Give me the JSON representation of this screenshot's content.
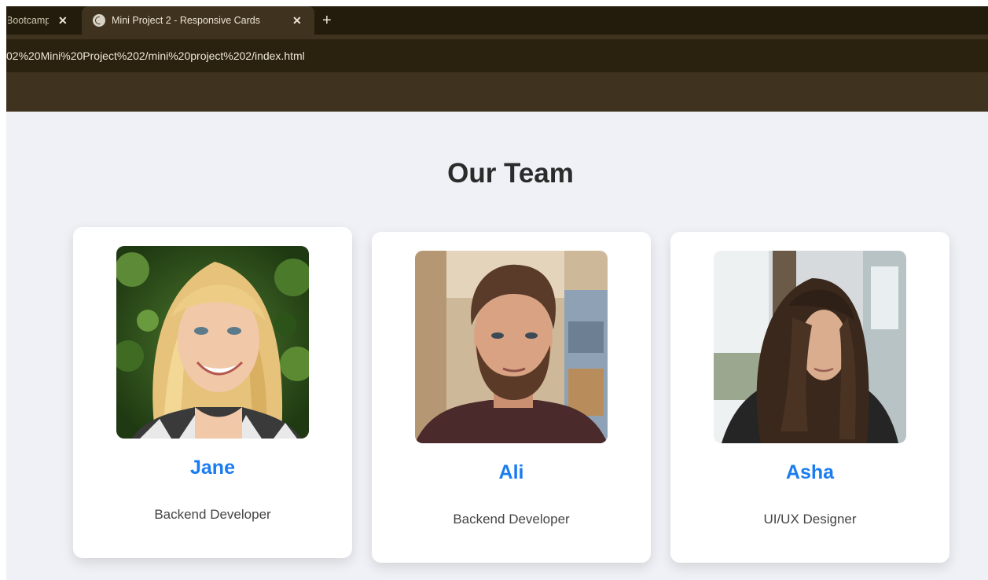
{
  "browser": {
    "tabs": [
      {
        "title": "Bootcamp",
        "close": "✕",
        "active": false
      },
      {
        "title": "Mini Project 2 - Responsive Cards",
        "close": "✕",
        "active": true
      }
    ],
    "new_tab": "+",
    "url": "02%20Mini%20Project%202/mini%20project%202/index.html"
  },
  "page": {
    "title": "Our Team",
    "members": [
      {
        "name": "Jane",
        "role": "Backend Developer",
        "photo": "photo-of-jane"
      },
      {
        "name": "Ali",
        "role": "Backend Developer",
        "photo": "photo-of-ali"
      },
      {
        "name": "Asha",
        "role": "UI/UX Designer",
        "photo": "photo-of-asha"
      }
    ]
  },
  "colors": {
    "name_accent": "#1a7cf0",
    "page_background": "#f0f1f6",
    "browser_chrome": "#3f331f"
  }
}
